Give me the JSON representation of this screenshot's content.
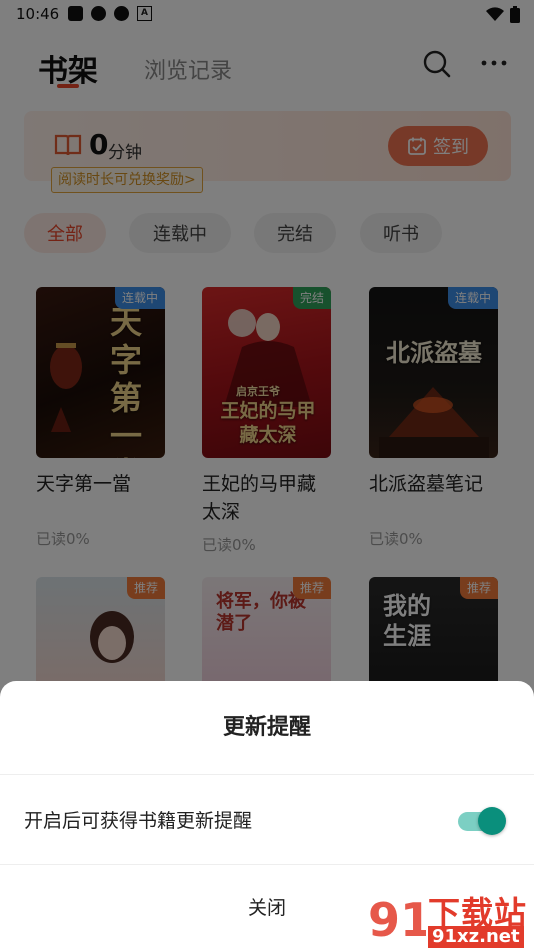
{
  "status_bar": {
    "time": "10:46",
    "notification_letter": "A"
  },
  "header": {
    "tabs": [
      {
        "label": "书架"
      },
      {
        "label": "浏览记录"
      }
    ]
  },
  "reading_card": {
    "minutes_value": "0",
    "minutes_unit": "分钟",
    "redeem_text": "阅读时长可兑换奖励>",
    "checkin_label": "签到"
  },
  "filters": [
    {
      "label": "全部",
      "active": true
    },
    {
      "label": "连载中"
    },
    {
      "label": "完结"
    },
    {
      "label": "听书"
    }
  ],
  "books": [
    {
      "title": "天字第一當",
      "progress": "已读0%",
      "badge": "连载中",
      "cover_text": "天字第一當"
    },
    {
      "title": "王妃的马甲藏太深",
      "progress": "已读0%",
      "badge": "完结",
      "cover_text": "王妃的马甲藏太深",
      "cover_subtitle": "启京王爷"
    },
    {
      "title": "北派盗墓笔记",
      "progress": "已读0%",
      "badge": "连载中",
      "cover_text": "北派盜墓"
    },
    {
      "badge": "推荐"
    },
    {
      "badge": "推荐",
      "cover_text": "将军，你被潜了"
    },
    {
      "badge": "推荐",
      "cover_text": "我的生涯"
    }
  ],
  "sheet": {
    "title": "更新提醒",
    "setting_label": "开启后可获得书籍更新提醒",
    "toggle_on": true,
    "close_label": "关闭"
  },
  "watermark": {
    "line1": "下载站",
    "line2": "91xz.net",
    "logo_text": "91"
  },
  "colors": {
    "accent": "#e8472b",
    "toggle": "#0a8f7c",
    "checkin": "#ef7350"
  }
}
